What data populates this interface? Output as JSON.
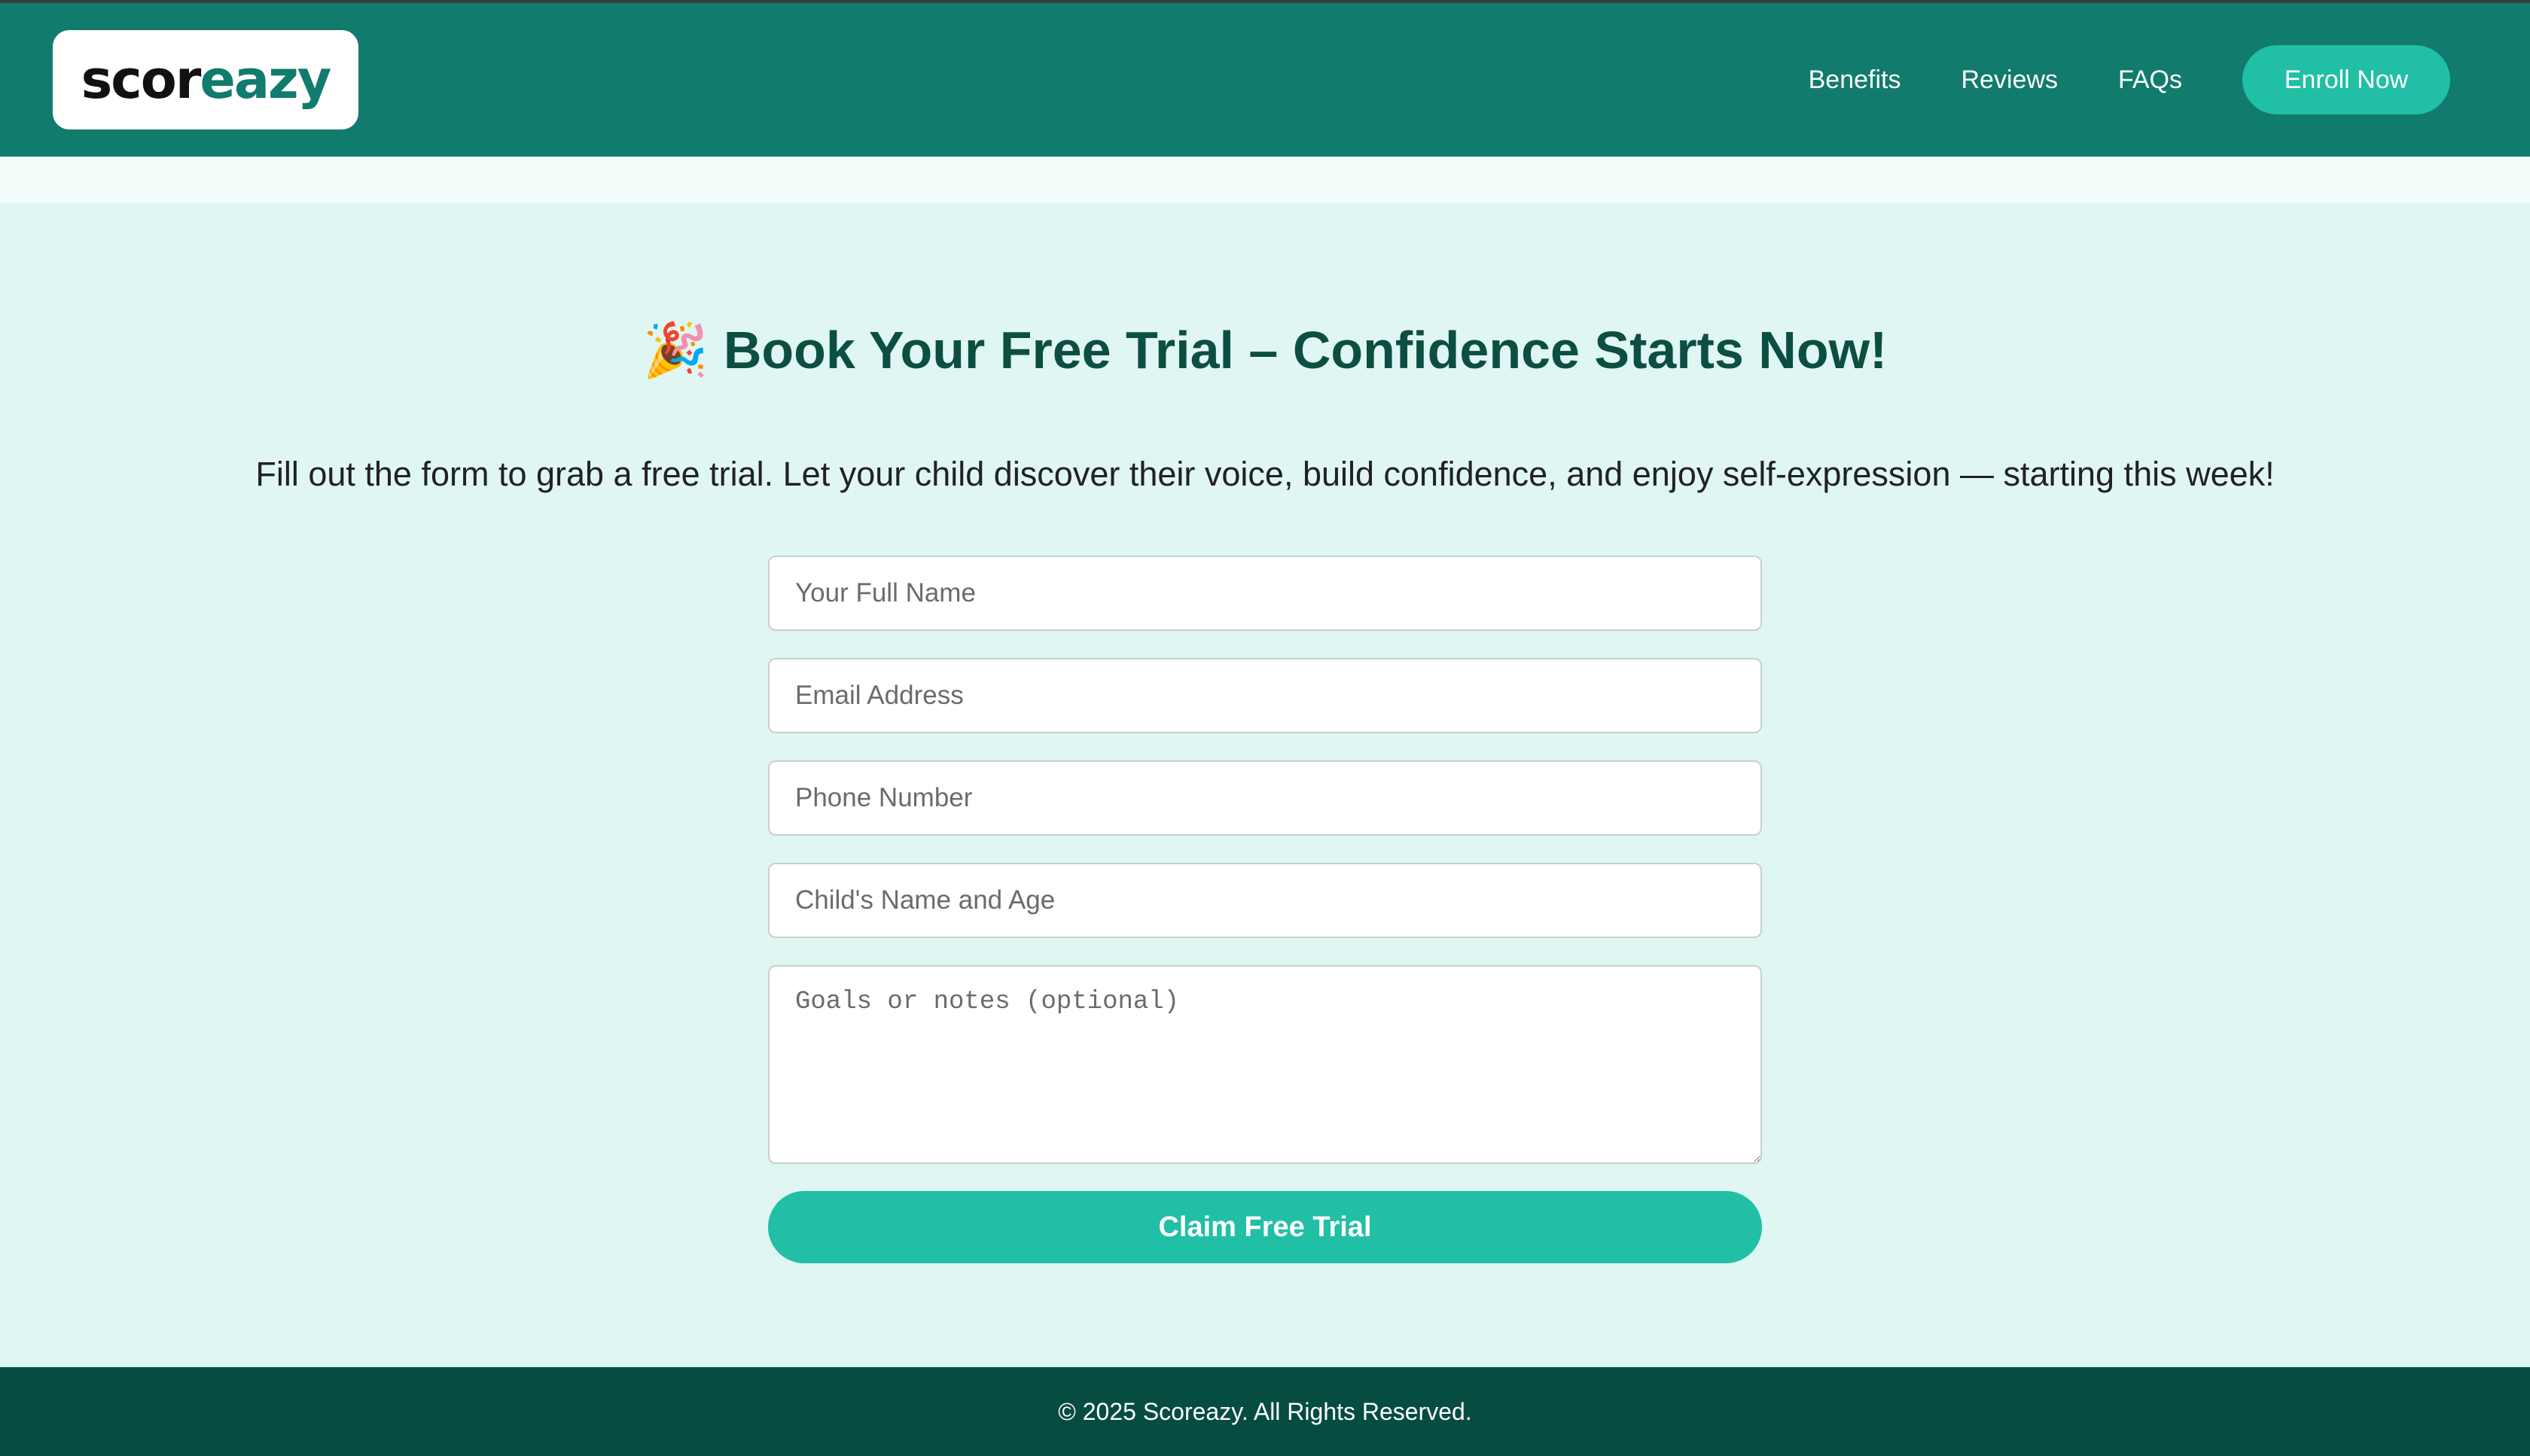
{
  "header": {
    "logo": {
      "part1": "scor",
      "part2": "eazy"
    },
    "nav": {
      "benefits": "Benefits",
      "reviews": "Reviews",
      "faqs": "FAQs",
      "enroll": "Enroll Now"
    }
  },
  "hero": {
    "emoji": "🎉",
    "title": "Book Your Free Trial – Confidence Starts Now!",
    "subtitle": "Fill out the form to grab a free trial. Let your child discover their voice, build confidence, and enjoy self-expression — starting this week!"
  },
  "form": {
    "full_name": {
      "placeholder": "Your Full Name",
      "value": ""
    },
    "email": {
      "placeholder": "Email Address",
      "value": ""
    },
    "phone": {
      "placeholder": "Phone Number",
      "value": ""
    },
    "child": {
      "placeholder": "Child's Name and Age",
      "value": ""
    },
    "notes": {
      "placeholder": "Goals or notes (optional)",
      "value": ""
    },
    "submit_label": "Claim Free Trial"
  },
  "footer": {
    "copyright": "© 2025 Scoreazy. All Rights Reserved."
  },
  "colors": {
    "header_bg": "#117b6d",
    "accent": "#20bfa6",
    "headline": "#0c4e42",
    "page_bg": "#e0f6f2",
    "footer_bg": "#074c40"
  }
}
